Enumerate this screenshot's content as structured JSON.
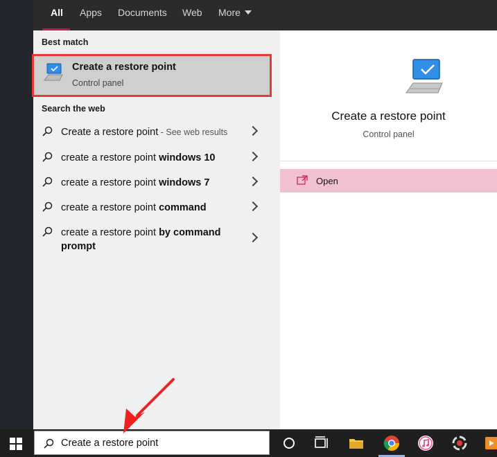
{
  "tabs": [
    "All",
    "Apps",
    "Documents",
    "Web",
    "More"
  ],
  "best_match": {
    "section": "Best match",
    "title": "Create a restore point",
    "subtitle": "Control panel",
    "icon": "computer-icon"
  },
  "web": {
    "section": "Search the web",
    "items": [
      {
        "plain": "Create a restore point",
        "bold": "",
        "hint": " - See web results"
      },
      {
        "plain": "create a restore point ",
        "bold": "windows 10",
        "hint": ""
      },
      {
        "plain": "create a restore point ",
        "bold": "windows 7",
        "hint": ""
      },
      {
        "plain": "create a restore point ",
        "bold": "command",
        "hint": ""
      },
      {
        "plain": "create a restore point ",
        "bold": "by command prompt",
        "hint": ""
      }
    ]
  },
  "detail": {
    "title": "Create a restore point",
    "subtitle": "Control panel",
    "action": "Open"
  },
  "search": {
    "value": "Create a restore point"
  },
  "colors": {
    "highlight_border": "#e53935",
    "tab_underline": "#c2185b",
    "open_row_bg": "#f1c1d1"
  },
  "taskbar_icons": [
    "windows-start-icon",
    "cortana-icon",
    "task-view-icon",
    "file-explorer-icon",
    "chrome-icon",
    "itunes-icon",
    "app-icon",
    "media-player-icon"
  ]
}
